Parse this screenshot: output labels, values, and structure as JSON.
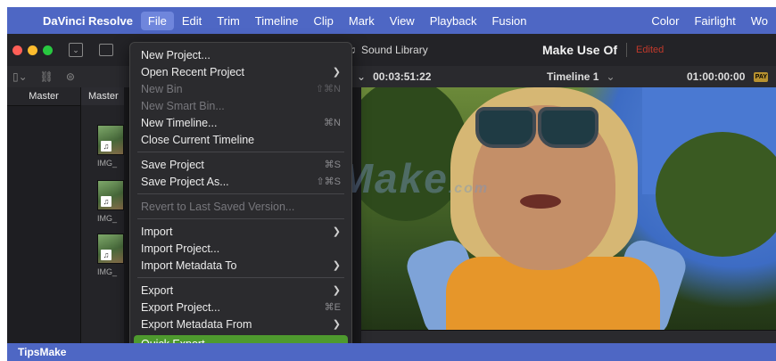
{
  "menubar": {
    "items": [
      "DaVinci Resolve",
      "File",
      "Edit",
      "Trim",
      "Timeline",
      "Clip",
      "Mark",
      "View",
      "Playback",
      "Fusion"
    ],
    "right_items": [
      "Color",
      "Fairlight",
      "Wo"
    ]
  },
  "toolbar": {
    "sound_library": "Sound Library",
    "project_name": "Make Use Of",
    "status": "Edited"
  },
  "toolbar2": {
    "source_timecode": "00:03:51:22",
    "timeline_name": "Timeline 1",
    "record_timecode": "01:00:00:00"
  },
  "panels": {
    "master_left": "Master",
    "master_mid": "Master",
    "clips": [
      "IMG_",
      "IMG_",
      "IMG_"
    ]
  },
  "file_menu": {
    "items": [
      {
        "label": "New Project...",
        "shortcut": "",
        "submenu": false,
        "disabled": false
      },
      {
        "label": "Open Recent Project",
        "shortcut": "",
        "submenu": true,
        "disabled": false
      },
      {
        "label": "New Bin",
        "shortcut": "⇧⌘N",
        "submenu": false,
        "disabled": true
      },
      {
        "label": "New Smart Bin...",
        "shortcut": "",
        "submenu": false,
        "disabled": true
      },
      {
        "label": "New Timeline...",
        "shortcut": "⌘N",
        "submenu": false,
        "disabled": false
      },
      {
        "label": "Close Current Timeline",
        "shortcut": "",
        "submenu": false,
        "disabled": false
      },
      {
        "label": "Save Project",
        "shortcut": "⌘S",
        "submenu": false,
        "disabled": false
      },
      {
        "label": "Save Project As...",
        "shortcut": "⇧⌘S",
        "submenu": false,
        "disabled": false
      },
      {
        "label": "Revert to Last Saved Version...",
        "shortcut": "",
        "submenu": false,
        "disabled": true
      },
      {
        "label": "Import",
        "shortcut": "",
        "submenu": true,
        "disabled": false
      },
      {
        "label": "Import Project...",
        "shortcut": "",
        "submenu": false,
        "disabled": false
      },
      {
        "label": "Import Metadata To",
        "shortcut": "",
        "submenu": true,
        "disabled": false
      },
      {
        "label": "Export",
        "shortcut": "",
        "submenu": true,
        "disabled": false
      },
      {
        "label": "Export Project...",
        "shortcut": "⌘E",
        "submenu": false,
        "disabled": false
      },
      {
        "label": "Export Metadata From",
        "shortcut": "",
        "submenu": true,
        "disabled": false
      },
      {
        "label": "Quick Export...",
        "shortcut": "",
        "submenu": false,
        "disabled": false
      }
    ]
  },
  "watermark": {
    "text": "TipsMake",
    "suffix": ".com"
  },
  "brandbar": {
    "text": "TipsMake"
  },
  "colors": {
    "menubar": "#4e67c4",
    "highlight": "#4e9a2e",
    "edited": "#c0392b"
  }
}
